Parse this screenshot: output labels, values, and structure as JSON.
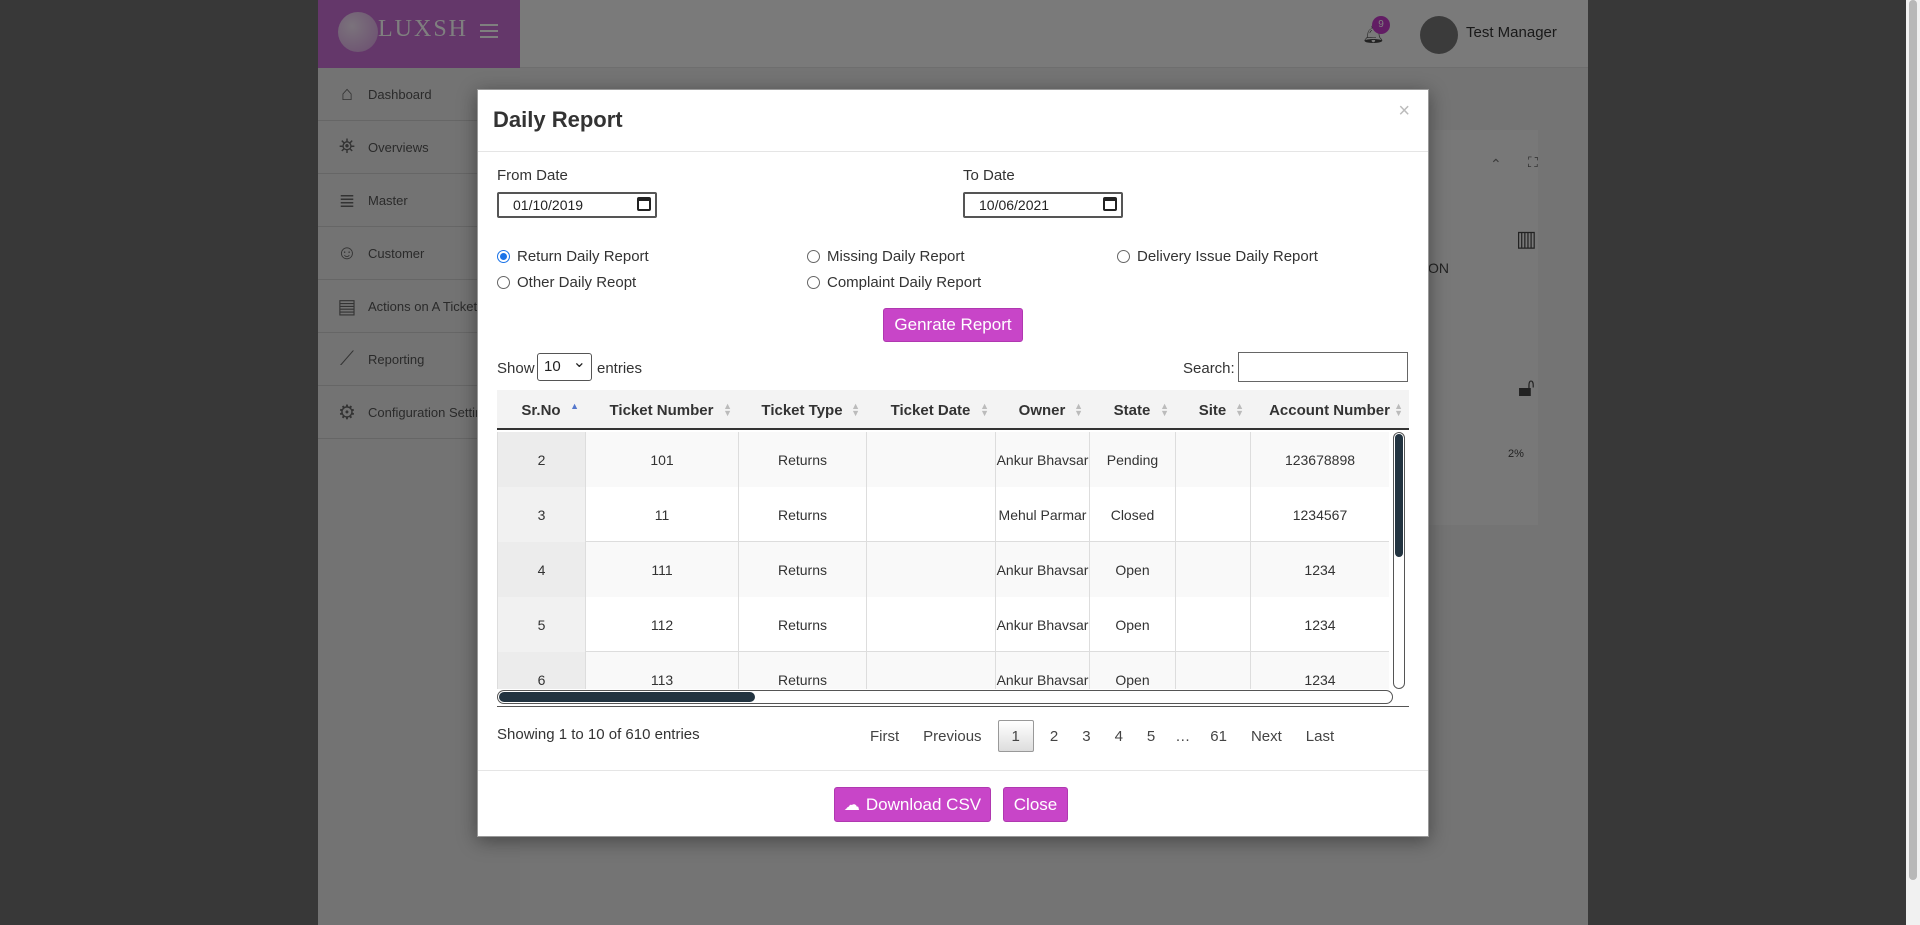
{
  "app": {
    "brand": "LUXSH",
    "notification_count": "9",
    "user_name": "Test Manager",
    "sidebar": [
      {
        "label": "Dashboard",
        "icon": "home-icon"
      },
      {
        "label": "Overviews",
        "icon": "binoculars-icon"
      },
      {
        "label": "Master",
        "icon": "database-icon"
      },
      {
        "label": "Customer",
        "icon": "user-icon"
      },
      {
        "label": "Actions on A Ticket",
        "icon": "book-icon"
      },
      {
        "label": "Reporting",
        "icon": "chart-line-icon"
      },
      {
        "label": "Configuration Settings",
        "icon": "user-cog-icon"
      }
    ],
    "bg_text_on": "ON",
    "bg_percent": "2%"
  },
  "modal": {
    "title": "Daily Report",
    "close_glyph": "×",
    "from_date_label": "From Date",
    "from_date_value": "01/10/2019",
    "to_date_label": "To Date",
    "to_date_value": "10/06/2021",
    "radios": [
      {
        "label": "Return Daily Report",
        "checked": true
      },
      {
        "label": "Missing Daily Report",
        "checked": false
      },
      {
        "label": "Delivery Issue Daily Report",
        "checked": false
      },
      {
        "label": "Other Daily Reopt",
        "checked": false
      },
      {
        "label": "Complaint Daily Report",
        "checked": false
      }
    ],
    "generate_button": "Genrate Report",
    "show_label": "Show",
    "entries_value": "10",
    "entries_label": "entries",
    "search_label": "Search:",
    "search_value": "",
    "columns": [
      "Sr.No",
      "Ticket Number",
      "Ticket Type",
      "Ticket Date",
      "Owner",
      "State",
      "Site",
      "Account Number"
    ],
    "rows": [
      [
        "2",
        "101",
        "Returns",
        "",
        "Ankur Bhavsar",
        "Pending",
        "",
        "123678898"
      ],
      [
        "3",
        "11",
        "Returns",
        "",
        "Mehul Parmar",
        "Closed",
        "",
        "1234567"
      ],
      [
        "4",
        "111",
        "Returns",
        "",
        "Ankur Bhavsar",
        "Open",
        "",
        "1234"
      ],
      [
        "5",
        "112",
        "Returns",
        "",
        "Ankur Bhavsar",
        "Open",
        "",
        "1234"
      ],
      [
        "6",
        "113",
        "Returns",
        "",
        "Ankur Bhavsar",
        "Open",
        "",
        "1234"
      ]
    ],
    "info_text": "Showing 1 to 10 of 610 entries",
    "pager": {
      "first": "First",
      "previous": "Previous",
      "pages": [
        "1",
        "2",
        "3",
        "4",
        "5"
      ],
      "current": "1",
      "ellipsis": "…",
      "last_page": "61",
      "next": "Next",
      "last": "Last"
    },
    "download_button": "Download CSV",
    "close_button": "Close"
  }
}
